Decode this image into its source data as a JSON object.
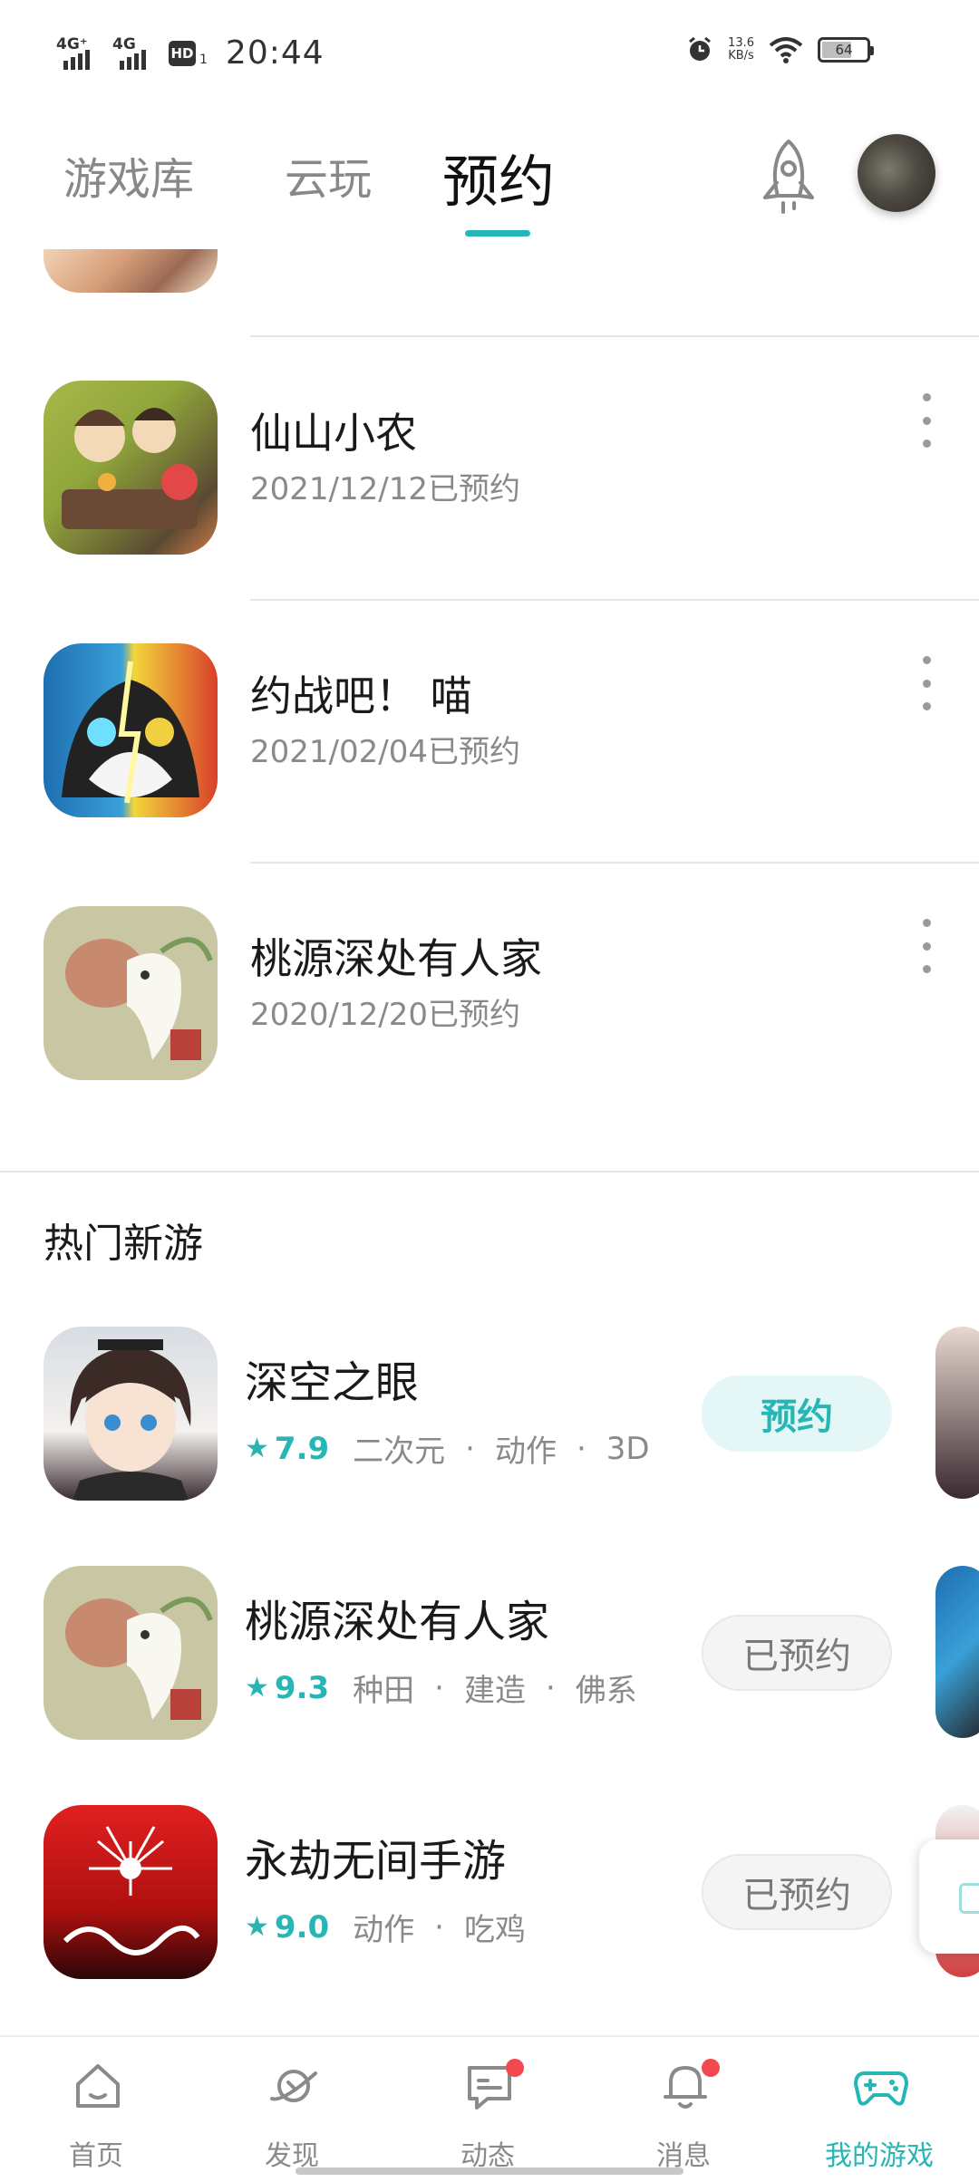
{
  "status_bar": {
    "network1": "4G⁺",
    "network2": "4G",
    "hd": "HD",
    "hd_sub": "1",
    "time": "20:44",
    "net_speed_value": "13.6",
    "net_speed_unit": "KB/s",
    "battery": "64"
  },
  "top_nav": {
    "tabs": [
      {
        "label": "游戏库"
      },
      {
        "label": "云玩"
      },
      {
        "label": "预约"
      }
    ],
    "active_tab": "预约"
  },
  "reserved": [
    {
      "title": "仙山小农",
      "date": "2021/12/12已预约"
    },
    {
      "title": "约战吧！ 喵",
      "date": "2021/02/04已预约"
    },
    {
      "title": "桃源深处有人家",
      "date": "2020/12/20已预约"
    }
  ],
  "hot_section": {
    "title": "热门新游",
    "items": [
      {
        "title": "深空之眼",
        "score": "7.9",
        "tags": [
          "二次元",
          "动作",
          "3D"
        ],
        "action": "预约"
      },
      {
        "title": "桃源深处有人家",
        "score": "9.3",
        "tags": [
          "种田",
          "建造",
          "佛系"
        ],
        "action": "已预约"
      },
      {
        "title": "永劫无间手游",
        "score": "9.0",
        "tags": [
          "动作",
          "吃鸡"
        ],
        "action": "已预约"
      }
    ]
  },
  "bottom_nav": {
    "items": [
      {
        "label": "首页",
        "icon": "home-icon"
      },
      {
        "label": "发现",
        "icon": "planet-icon"
      },
      {
        "label": "动态",
        "icon": "message-icon"
      },
      {
        "label": "消息",
        "icon": "bell-icon"
      },
      {
        "label": "我的游戏",
        "icon": "gamepad-icon"
      }
    ],
    "active": "我的游戏"
  },
  "colors": {
    "accent": "#26b6b6",
    "badge": "#f2484f"
  }
}
